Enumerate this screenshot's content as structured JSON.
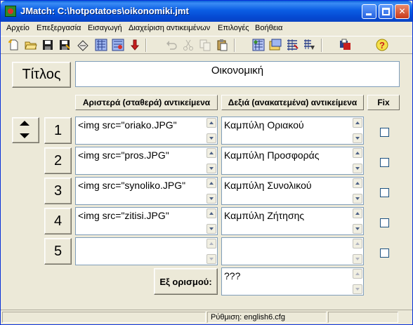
{
  "window": {
    "title": "JMatch: C:\\hotpotatoes\\oikonomiki.jmt"
  },
  "menu": [
    "Αρχείο",
    "Επεξεργασία",
    "Εισαγωγή",
    "Διαχείριση αντικειμένων",
    "Επιλογές",
    "Βοήθεια"
  ],
  "toolbar": [
    {
      "icon": "new-file-icon"
    },
    {
      "icon": "open-folder-icon"
    },
    {
      "icon": "save-icon"
    },
    {
      "icon": "save-as-icon"
    },
    {
      "icon": "clear-icon"
    },
    {
      "icon": "export-webpage-icon"
    },
    {
      "icon": "export-dragdrop-icon"
    },
    {
      "icon": "down-arrow-icon"
    },
    {
      "icon": "undo-icon"
    },
    {
      "icon": "cut-icon"
    },
    {
      "icon": "copy-icon"
    },
    {
      "icon": "paste-icon"
    },
    {
      "icon": "web-page-icon"
    },
    {
      "icon": "add-item-icon"
    },
    {
      "icon": "shuffle-icon"
    },
    {
      "icon": "hot-potatoes-icon"
    },
    {
      "icon": "config-icon"
    },
    {
      "icon": "help-icon"
    }
  ],
  "title_label": "Τίτλος",
  "title_value": "Οικονομική",
  "headers": {
    "left": "Αριστερά (σταθερά) αντικείμενα",
    "right": "Δεξιά (ανακατεμένα) αντικείμενα",
    "fix": "Fix"
  },
  "rows": [
    {
      "num": "1",
      "left": "<img src=\"oriako.JPG\"",
      "right": "Καμπύλη Οριακού",
      "fix": false
    },
    {
      "num": "2",
      "left": "<img src=\"pros.JPG\"",
      "right": "Καμπύλη Προσφοράς",
      "fix": false
    },
    {
      "num": "3",
      "left": "<img src=\"synoliko.JPG\"",
      "right": "Καμπύλη Συνολικού",
      "fix": false
    },
    {
      "num": "4",
      "left": "<img src=\"zitisi.JPG\"",
      "right": "Καμπύλη Ζήτησης",
      "fix": false
    },
    {
      "num": "5",
      "left": "",
      "right": "",
      "fix": false
    }
  ],
  "default_label": "Εξ ορισμού:",
  "default_value": "???",
  "status": "Ρύθμιση: english6.cfg"
}
